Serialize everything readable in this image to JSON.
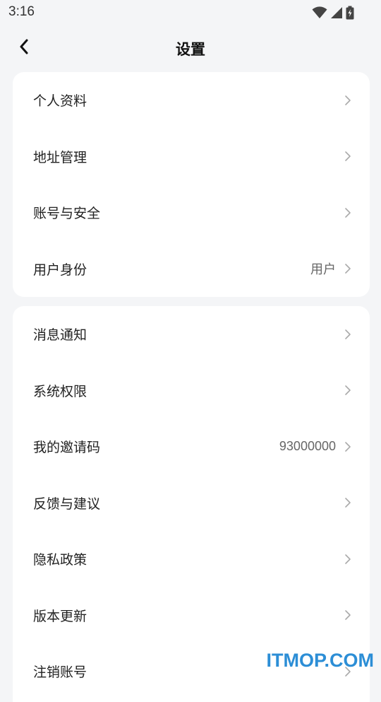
{
  "status_bar": {
    "time": "3:16",
    "icons": [
      "wifi-icon",
      "cellular-signal-icon",
      "battery-charging-icon"
    ]
  },
  "header": {
    "title": "设置",
    "back_icon": "chevron-left-icon"
  },
  "groups": [
    {
      "items": [
        {
          "label": "个人资料",
          "value": ""
        },
        {
          "label": "地址管理",
          "value": ""
        },
        {
          "label": "账号与安全",
          "value": ""
        },
        {
          "label": "用户身份",
          "value": "用户"
        }
      ]
    },
    {
      "items": [
        {
          "label": "消息通知",
          "value": ""
        },
        {
          "label": "系统权限",
          "value": ""
        },
        {
          "label": "我的邀请码",
          "value": "93000000"
        },
        {
          "label": "反馈与建议",
          "value": ""
        },
        {
          "label": "隐私政策",
          "value": ""
        },
        {
          "label": "版本更新",
          "value": ""
        },
        {
          "label": "注销账号",
          "value": ""
        }
      ]
    }
  ],
  "watermark": "ITMOP.COM",
  "colors": {
    "background": "#f4f5f7",
    "card": "#ffffff",
    "watermark": "#2c8ed6"
  }
}
